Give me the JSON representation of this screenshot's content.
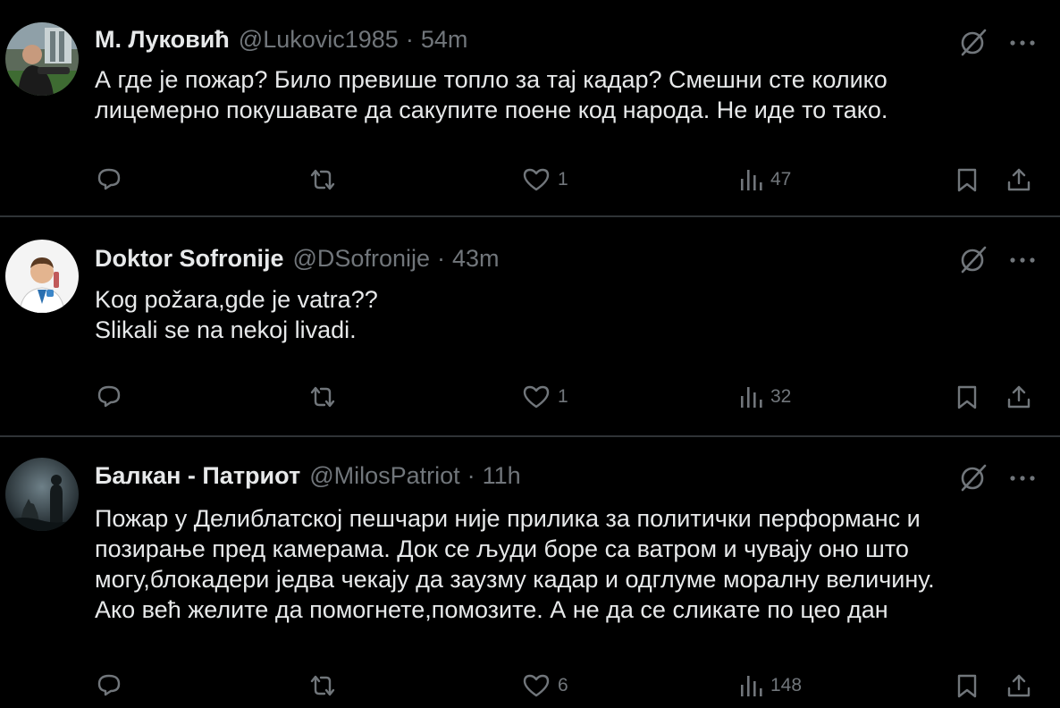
{
  "tweets": [
    {
      "name": "М. Луковић",
      "handle": "@Lukovic1985",
      "separator": "·",
      "time": "54m",
      "text_lines": [
        "А где је пожар? Било превише топло за тај кадар? Смешни сте колико",
        "лицемерно покушавате да сакупите поене код народа. Не иде то тако."
      ],
      "likes": "1",
      "views": "47"
    },
    {
      "name": "Doktor Sofronije",
      "handle": "@DSofronije",
      "separator": "·",
      "time": "43m",
      "text_lines": [
        "Kog požara,gde je vatra??",
        "Slikali se na nekoj livadi."
      ],
      "likes": "1",
      "views": "32"
    },
    {
      "name": "Балкан - Патриот",
      "handle": "@MilosPatriot",
      "separator": "·",
      "time": "11h",
      "text_lines": [
        "Пожар у Делиблатској пешчари није прилика за политички перформанс и",
        "позирање пред камерама. Док се људи боре са ватром и чувају оно што",
        "могу,блокадери једва чекају да заузму кадар и одглуме моралну величину.",
        "Ако већ желите да помогнете,помозите. А не да се сликате по цео дан"
      ],
      "likes": "6",
      "views": "148"
    }
  ],
  "icons": {
    "reply": "reply-icon",
    "retweet": "retweet-icon",
    "like": "heart-icon",
    "views": "views-icon",
    "bookmark": "bookmark-icon",
    "share": "share-icon",
    "grok": "grok-icon",
    "more": "more-icon"
  },
  "colors": {
    "background": "#000000",
    "text": "#e7e9ea",
    "secondary": "#71767b",
    "divider": "#2f3336"
  }
}
